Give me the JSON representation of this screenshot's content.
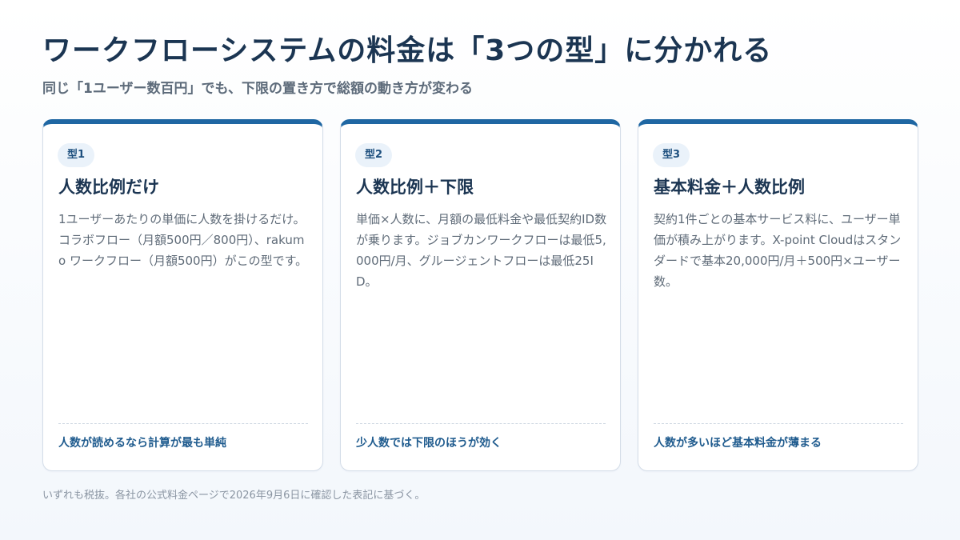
{
  "header": {
    "title": "ワークフローシステムの料金は「3つの型」に分かれる",
    "subtitle": "同じ「1ユーザー数百円」でも、下限の置き方で総額の動き方が変わる"
  },
  "cards": [
    {
      "badge": "型1",
      "title": "人数比例だけ",
      "description": "1ユーザーあたりの単価に人数を掛けるだけ。コラボフロー（月額500円／800円）、rakumo ワークフロー（月額500円）がこの型です。",
      "note": "人数が読めるなら計算が最も単純"
    },
    {
      "badge": "型2",
      "title": "人数比例＋下限",
      "description": "単価×人数に、月額の最低料金や最低契約ID数が乗ります。ジョブカンワークフローは最低5,000円/月、グルージェントフローは最低25ID。",
      "note": "少人数では下限のほうが効く"
    },
    {
      "badge": "型3",
      "title": "基本料金＋人数比例",
      "description": "契約1件ごとの基本サービス料に、ユーザー単価が積み上がります。X-point Cloudはスタンダードで基本20,000円/月＋500円×ユーザー数。",
      "note": "人数が多いほど基本料金が薄まる"
    }
  ],
  "footnote": "いずれも税抜。各社の公式料金ページで2026年9月6日に確認した表記に基づく。",
  "colors": {
    "accent": "#1f67a3",
    "title": "#1b3552",
    "note": "#1f5b8e",
    "badge_bg": "#eaf2fa"
  }
}
